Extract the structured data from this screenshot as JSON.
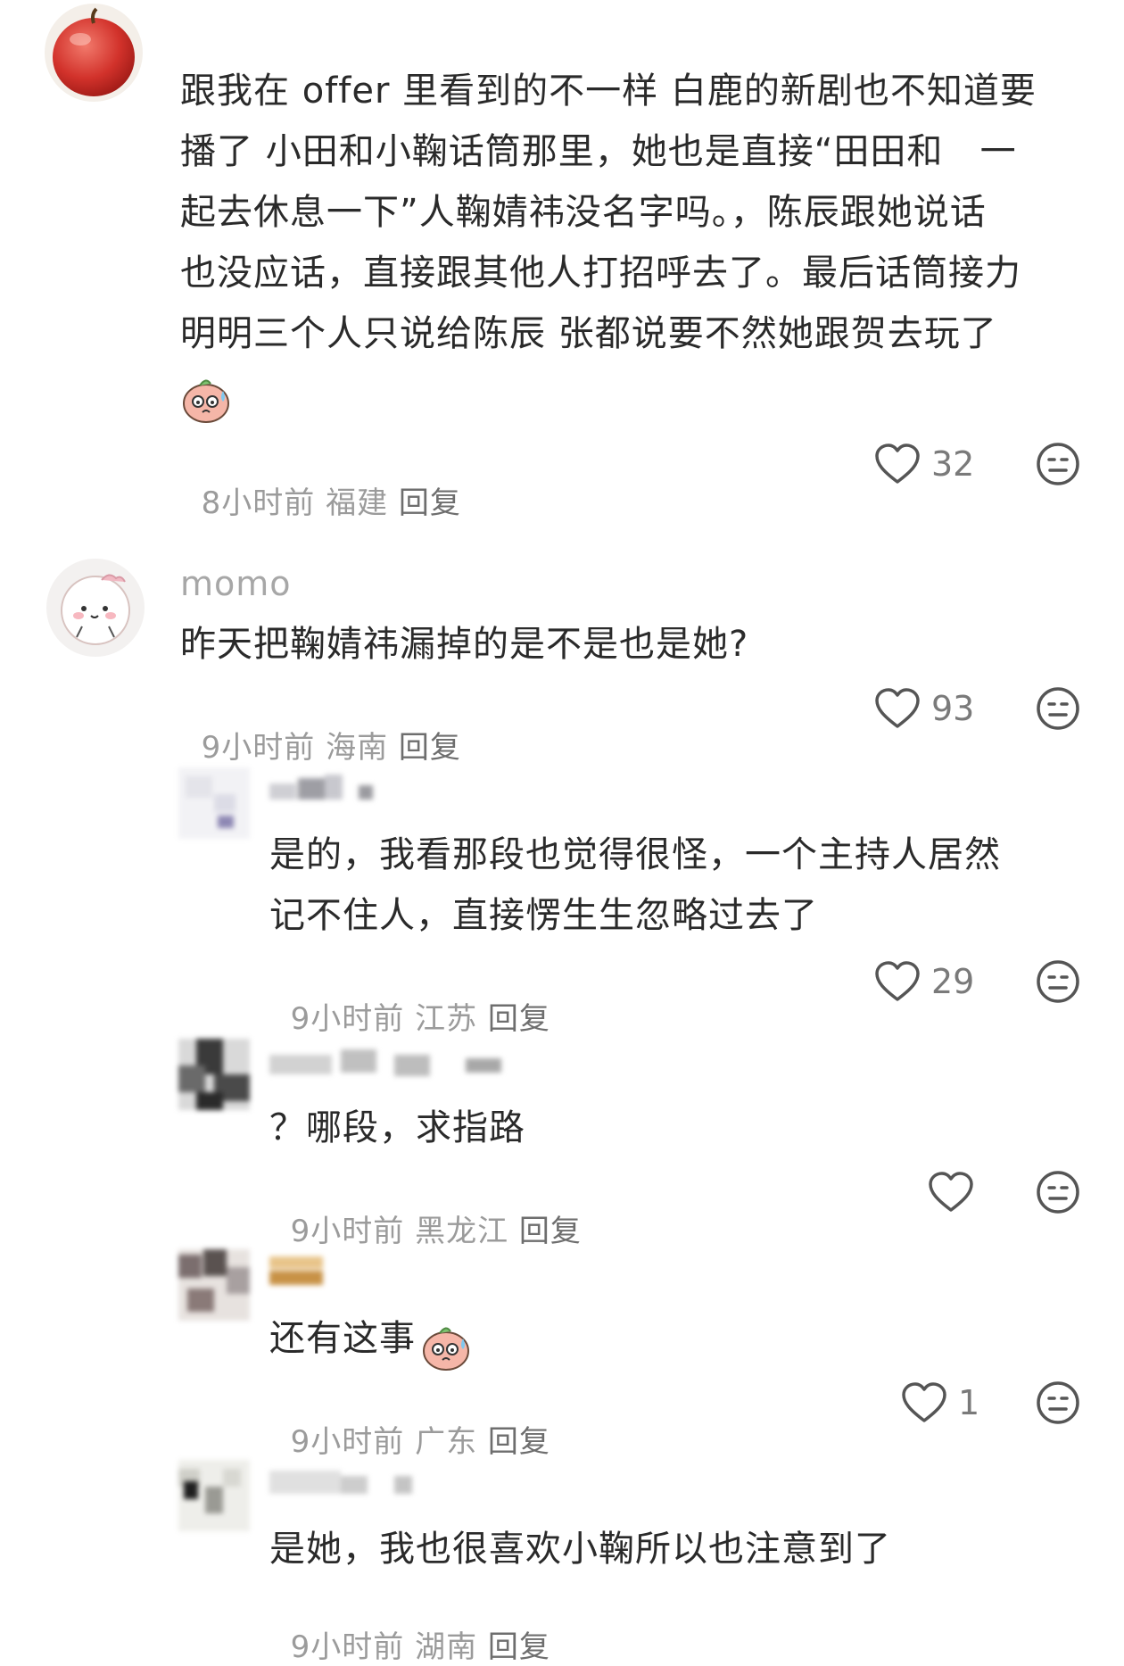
{
  "comments": [
    {
      "text_lines": [
        "跟我在 offer 里看到的不一样 白鹿的新剧也不知道要",
        "播了 小田和小鞠话筒那里，她也是直接“田田和   一",
        "起去休息一下”人鞠婧祎没名字吗。，陈辰跟她说话",
        "也没应话，直接跟其他人打招呼去了。最后话筒接力",
        "明明三个人只说给陈辰 张都说要不然她跟贺去玩了"
      ],
      "meta": "8小时前 福建 ",
      "reply": "回复",
      "likes": "32"
    },
    {
      "username": "momo",
      "text": "昨天把鞠婧祎漏掉的是不是也是她?",
      "meta": "9小时前 海南 ",
      "reply": "回复",
      "likes": "93"
    },
    {
      "text_lines": [
        "是的，我看那段也觉得很怪，一个主持人居然",
        "记不住人，直接愣生生忽略过去了"
      ],
      "meta": "9小时前 江苏 ",
      "reply": "回复",
      "likes": "29"
    },
    {
      "text": "？哪段，求指路",
      "meta": "9小时前 黑龙江 ",
      "reply": "回复",
      "likes": ""
    },
    {
      "text": "还有这事",
      "meta": "9小时前 广东 ",
      "reply": "回复",
      "likes": "1"
    },
    {
      "text": "是她，我也很喜欢小鞠所以也注意到了",
      "meta": "9小时前 湖南 ",
      "reply": "回复"
    }
  ],
  "icons": {
    "like": "heart-outline-icon",
    "dislike": "unamused-face-icon",
    "emoji": "sweat-peach-emoji"
  },
  "colors": {
    "text": "#2a2a2a",
    "meta": "#9b9b9b",
    "icon": "#555555"
  }
}
